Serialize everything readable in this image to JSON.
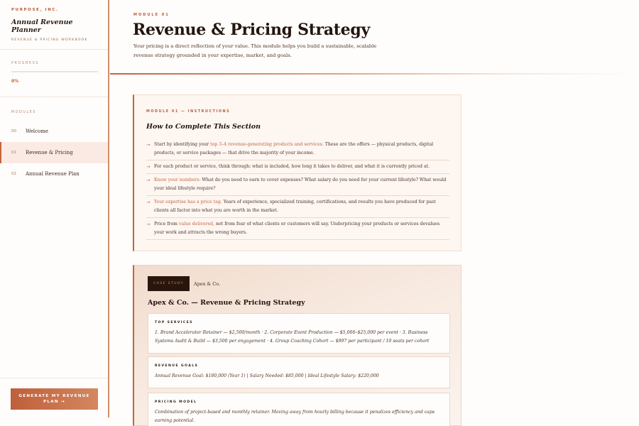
{
  "sidebar": {
    "company": "PURPOSE, INC.",
    "title": "Annual Revenue Planner",
    "subtitle": "REVENUE & PRICING WORKBOOK",
    "progress_label": "PROGRESS",
    "progress_value": "0%",
    "progress_fraction": 0,
    "modules_label": "MODULES",
    "modules": [
      {
        "num": "00",
        "label": "Welcome"
      },
      {
        "num": "01",
        "label": "Revenue & Pricing"
      },
      {
        "num": "02",
        "label": "Annual Revenue Plan"
      }
    ],
    "generate_label": "GENERATE MY REVENUE PLAN →"
  },
  "header": {
    "module_tag": "MODULE 01",
    "title": "Revenue & Pricing Strategy",
    "description": "Your pricing is a direct reflection of your value. This module helps you build a sustainable, scalable revenue strategy grounded in your expertise, market, and goals."
  },
  "instructions": {
    "tag": "MODULE 01 — INSTRUCTIONS",
    "title": "How to Complete This Section",
    "items": [
      {
        "pre": "Start by identifying your ",
        "hl": "top 3–4 revenue-generating products and services.",
        "post": " These are the offers — physical products, digital products, or service packages — that drive the majority of your income."
      },
      {
        "pre": "For each product or service, think through: what is included, how long it takes to deliver, and what it is currently priced at.",
        "hl": "",
        "post": ""
      },
      {
        "pre": "",
        "hl": "Know your numbers:",
        "post": " What do you need to earn to cover expenses? What salary do you need for your current lifestyle? What would your ideal lifestyle require?"
      },
      {
        "pre": "",
        "hl": "Your expertise has a price tag.",
        "post": " Years of experience, specialized training, certifications, and results you have produced for past clients all factor into what you are worth in the market."
      },
      {
        "pre": "Price from ",
        "hl": "value delivered,",
        "post": " not from fear of what clients or customers will say. Underpricing your products or services devalues your work and attracts the wrong buyers."
      }
    ]
  },
  "case_study": {
    "badge": "CASE STUDY",
    "company": "Apex & Co.",
    "title": "Apex & Co. — Revenue & Pricing Strategy",
    "boxes": [
      {
        "label": "TOP SERVICES",
        "text": "1. Brand Accelerator Retainer — $2,500/month · 2. Corporate Event Production — $5,000–$25,000 per event · 3. Business Systems Audit & Build — $3,500 per engagement · 4. Group Coaching Cohort — $997 per participant / 10 seats per cohort"
      },
      {
        "label": "REVENUE GOALS",
        "text": "Annual Revenue Goal: $180,000 (Year 1) | Salary Needed: $85,000 | Ideal Lifestyle Salary: $220,000"
      },
      {
        "label": "PRICING MODEL",
        "text": "Combination of project-based and monthly retainer. Moving away from hourly billing because it penalizes efficiency and caps earning potential."
      }
    ]
  }
}
